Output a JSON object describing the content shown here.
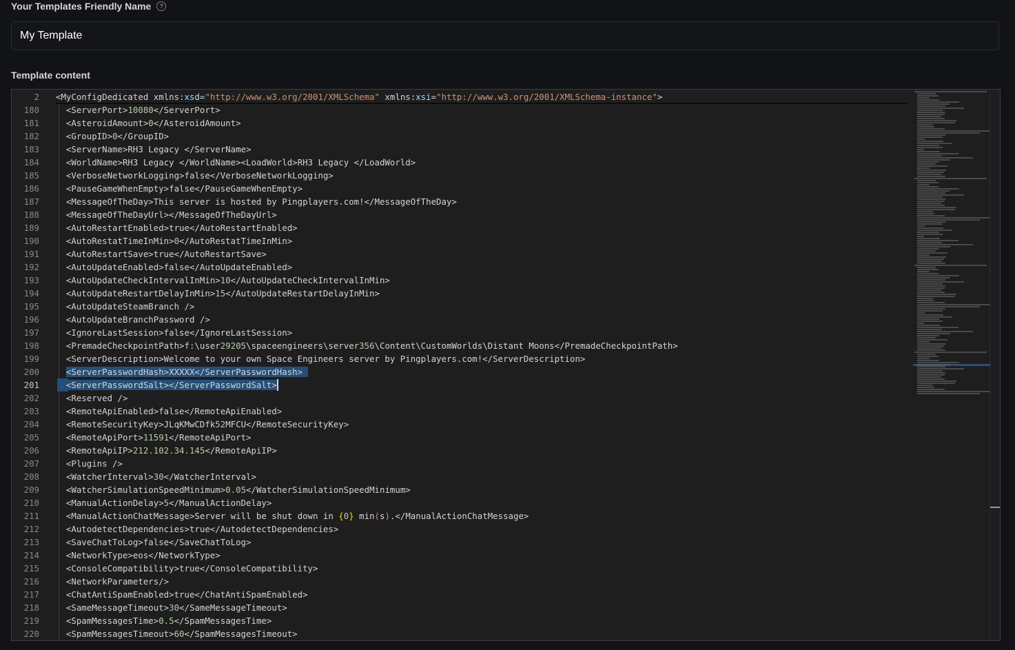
{
  "form": {
    "name_label": "Your Templates Friendly Name",
    "help_glyph": "?",
    "name_value": "My Template",
    "content_label": "Template content"
  },
  "editor": {
    "sticky": {
      "number": "2",
      "segments": [
        {
          "t": "<MyConfigDedicated xmlns:",
          "c": "tag"
        },
        {
          "t": "xsd",
          "c": "ns"
        },
        {
          "t": "=",
          "c": "tag"
        },
        {
          "t": "\"http://www.w3.org/2001/XMLSchema\"",
          "c": "str"
        },
        {
          "t": " xmlns:",
          "c": "tag"
        },
        {
          "t": "xsi",
          "c": "ns"
        },
        {
          "t": "=",
          "c": "tag"
        },
        {
          "t": "\"http://www.w3.org/2001/XMLSchema-instance\"",
          "c": "str"
        },
        {
          "t": ">",
          "c": "tag"
        }
      ]
    },
    "active_line": "201",
    "lines": [
      {
        "n": "180",
        "s": [
          {
            "t": "  <ServerPort>",
            "c": "tag"
          },
          {
            "t": "10080",
            "c": "val"
          },
          {
            "t": "</ServerPort>",
            "c": "tag"
          }
        ]
      },
      {
        "n": "181",
        "s": [
          {
            "t": "  <AsteroidAmount>",
            "c": "tag"
          },
          {
            "t": "0",
            "c": "val"
          },
          {
            "t": "</AsteroidAmount>",
            "c": "tag"
          }
        ]
      },
      {
        "n": "182",
        "s": [
          {
            "t": "  <GroupID>",
            "c": "tag"
          },
          {
            "t": "0",
            "c": "val"
          },
          {
            "t": "</GroupID>",
            "c": "tag"
          }
        ]
      },
      {
        "n": "183",
        "s": [
          {
            "t": "  <ServerName>RH3 Legacy </ServerName>",
            "c": "tag"
          }
        ]
      },
      {
        "n": "184",
        "s": [
          {
            "t": "  <WorldName>RH3 Legacy </WorldName><LoadWorld>RH3 Legacy </LoadWorld>",
            "c": "tag"
          }
        ]
      },
      {
        "n": "185",
        "s": [
          {
            "t": "  <VerboseNetworkLogging>false</VerboseNetworkLogging>",
            "c": "tag"
          }
        ]
      },
      {
        "n": "186",
        "s": [
          {
            "t": "  <PauseGameWhenEmpty>false</PauseGameWhenEmpty>",
            "c": "tag"
          }
        ]
      },
      {
        "n": "187",
        "s": [
          {
            "t": "  <MessageOfTheDay>This server is hosted by Pingplayers.com!</MessageOfTheDay>",
            "c": "tag"
          }
        ]
      },
      {
        "n": "188",
        "s": [
          {
            "t": "  <MessageOfTheDayUrl></MessageOfTheDayUrl>",
            "c": "tag"
          }
        ]
      },
      {
        "n": "189",
        "s": [
          {
            "t": "  <AutoRestartEnabled>true</AutoRestartEnabled>",
            "c": "tag"
          }
        ]
      },
      {
        "n": "190",
        "s": [
          {
            "t": "  <AutoRestatTimeInMin>",
            "c": "tag"
          },
          {
            "t": "0",
            "c": "val"
          },
          {
            "t": "</AutoRestatTimeInMin>",
            "c": "tag"
          }
        ]
      },
      {
        "n": "191",
        "s": [
          {
            "t": "  <AutoRestartSave>true</AutoRestartSave>",
            "c": "tag"
          }
        ]
      },
      {
        "n": "192",
        "s": [
          {
            "t": "  <AutoUpdateEnabled>false</AutoUpdateEnabled>",
            "c": "tag"
          }
        ]
      },
      {
        "n": "193",
        "s": [
          {
            "t": "  <AutoUpdateCheckIntervalInMin>",
            "c": "tag"
          },
          {
            "t": "10",
            "c": "val"
          },
          {
            "t": "</AutoUpdateCheckIntervalInMin>",
            "c": "tag"
          }
        ]
      },
      {
        "n": "194",
        "s": [
          {
            "t": "  <AutoUpdateRestartDelayInMin>",
            "c": "tag"
          },
          {
            "t": "15",
            "c": "val"
          },
          {
            "t": "</AutoUpdateRestartDelayInMin>",
            "c": "tag"
          }
        ]
      },
      {
        "n": "195",
        "s": [
          {
            "t": "  <AutoUpdateSteamBranch />",
            "c": "tag"
          }
        ]
      },
      {
        "n": "196",
        "s": [
          {
            "t": "  <AutoUpdateBranchPassword />",
            "c": "tag"
          }
        ]
      },
      {
        "n": "197",
        "s": [
          {
            "t": "  <IgnoreLastSession>false</IgnoreLastSession>",
            "c": "tag"
          }
        ]
      },
      {
        "n": "198",
        "s": [
          {
            "t": "  <PremadeCheckpointPath>f:\\user",
            "c": "tag"
          },
          {
            "t": "29205",
            "c": "val"
          },
          {
            "t": "\\spaceengineers\\server",
            "c": "tag"
          },
          {
            "t": "356",
            "c": "val"
          },
          {
            "t": "\\Content\\CustomWorlds\\Distant Moons</PremadeCheckpointPath>",
            "c": "tag"
          }
        ]
      },
      {
        "n": "199",
        "s": [
          {
            "t": "  <ServerDescription>Welcome to your own Space Engineers server by Pingplayers.com!</ServerDescription>",
            "c": "tag"
          }
        ]
      },
      {
        "n": "200",
        "s": [
          {
            "t": "  ",
            "c": "tag"
          },
          {
            "t": "<ServerPasswordHash>XXXXX</ServerPasswordHash> ",
            "c": "sel"
          }
        ]
      },
      {
        "n": "201",
        "s": [
          {
            "t": "  ",
            "c": "tag"
          },
          {
            "t": "<ServerPasswordSalt></ServerPasswordSalt>",
            "c": "sel"
          }
        ]
      },
      {
        "n": "202",
        "s": [
          {
            "t": "  <Reserved />",
            "c": "tag"
          }
        ]
      },
      {
        "n": "203",
        "s": [
          {
            "t": "  <RemoteApiEnabled>false</RemoteApiEnabled>",
            "c": "tag"
          }
        ]
      },
      {
        "n": "204",
        "s": [
          {
            "t": "  <RemoteSecurityKey>JLqKMwCDfk",
            "c": "tag"
          },
          {
            "t": "52",
            "c": "val"
          },
          {
            "t": "MFCU</RemoteSecurityKey>",
            "c": "tag"
          }
        ]
      },
      {
        "n": "205",
        "s": [
          {
            "t": "  <RemoteApiPort>",
            "c": "tag"
          },
          {
            "t": "11591",
            "c": "val"
          },
          {
            "t": "</RemoteApiPort>",
            "c": "tag"
          }
        ]
      },
      {
        "n": "206",
        "s": [
          {
            "t": "  <RemoteApiIP>",
            "c": "tag"
          },
          {
            "t": "212.102.34.145",
            "c": "val"
          },
          {
            "t": "</RemoteApiIP>",
            "c": "tag"
          }
        ]
      },
      {
        "n": "207",
        "s": [
          {
            "t": "  <Plugins />",
            "c": "tag"
          }
        ]
      },
      {
        "n": "208",
        "s": [
          {
            "t": "  <WatcherInterval>",
            "c": "tag"
          },
          {
            "t": "30",
            "c": "val"
          },
          {
            "t": "</WatcherInterval>",
            "c": "tag"
          }
        ]
      },
      {
        "n": "209",
        "s": [
          {
            "t": "  <WatcherSimulationSpeedMinimum>",
            "c": "tag"
          },
          {
            "t": "0.05",
            "c": "val"
          },
          {
            "t": "</WatcherSimulationSpeedMinimum>",
            "c": "tag"
          }
        ]
      },
      {
        "n": "210",
        "s": [
          {
            "t": "  <ManualActionDelay>",
            "c": "tag"
          },
          {
            "t": "5",
            "c": "val"
          },
          {
            "t": "</ManualActionDelay>",
            "c": "tag"
          }
        ]
      },
      {
        "n": "211",
        "s": [
          {
            "t": "  <ManualActionChatMessage>Server will be shut down in ",
            "c": "tag"
          },
          {
            "t": "{",
            "c": "brace"
          },
          {
            "t": "0",
            "c": "val"
          },
          {
            "t": "}",
            "c": "brace"
          },
          {
            "t": " min",
            "c": "tag"
          },
          {
            "t": "(",
            "c": "paren"
          },
          {
            "t": "s",
            "c": "tag"
          },
          {
            "t": ")",
            "c": "paren"
          },
          {
            "t": ".</ManualActionChatMessage>",
            "c": "tag"
          }
        ]
      },
      {
        "n": "212",
        "s": [
          {
            "t": "  <AutodetectDependencies>true</AutodetectDependencies>",
            "c": "tag"
          }
        ]
      },
      {
        "n": "213",
        "s": [
          {
            "t": "  <SaveChatToLog>false</SaveChatToLog>",
            "c": "tag"
          }
        ]
      },
      {
        "n": "214",
        "s": [
          {
            "t": "  <NetworkType>eos</NetworkType>",
            "c": "tag"
          }
        ]
      },
      {
        "n": "215",
        "s": [
          {
            "t": "  <ConsoleCompatibility>true</ConsoleCompatibility>",
            "c": "tag"
          }
        ]
      },
      {
        "n": "216",
        "s": [
          {
            "t": "  <NetworkParameters/>",
            "c": "tag"
          }
        ]
      },
      {
        "n": "217",
        "s": [
          {
            "t": "  <ChatAntiSpamEnabled>true</ChatAntiSpamEnabled>",
            "c": "tag"
          }
        ]
      },
      {
        "n": "218",
        "s": [
          {
            "t": "  <SameMessageTimeout>",
            "c": "tag"
          },
          {
            "t": "30",
            "c": "val"
          },
          {
            "t": "</SameMessageTimeout>",
            "c": "tag"
          }
        ]
      },
      {
        "n": "219",
        "s": [
          {
            "t": "  <SpamMessagesTime>",
            "c": "tag"
          },
          {
            "t": "0.5",
            "c": "val"
          },
          {
            "t": "</SpamMessagesTime>",
            "c": "tag"
          }
        ]
      },
      {
        "n": "220",
        "s": [
          {
            "t": "  <SpamMessagesTimeout>",
            "c": "tag"
          },
          {
            "t": "60",
            "c": "val"
          },
          {
            "t": "</SpamMessagesTimeout>",
            "c": "tag"
          }
        ]
      }
    ]
  },
  "colors": {
    "tag": "#d4d4d4",
    "value": "#b5cea8",
    "string": "#ce9178",
    "namespace": "#9cdcfe",
    "selection": "#264f78"
  }
}
